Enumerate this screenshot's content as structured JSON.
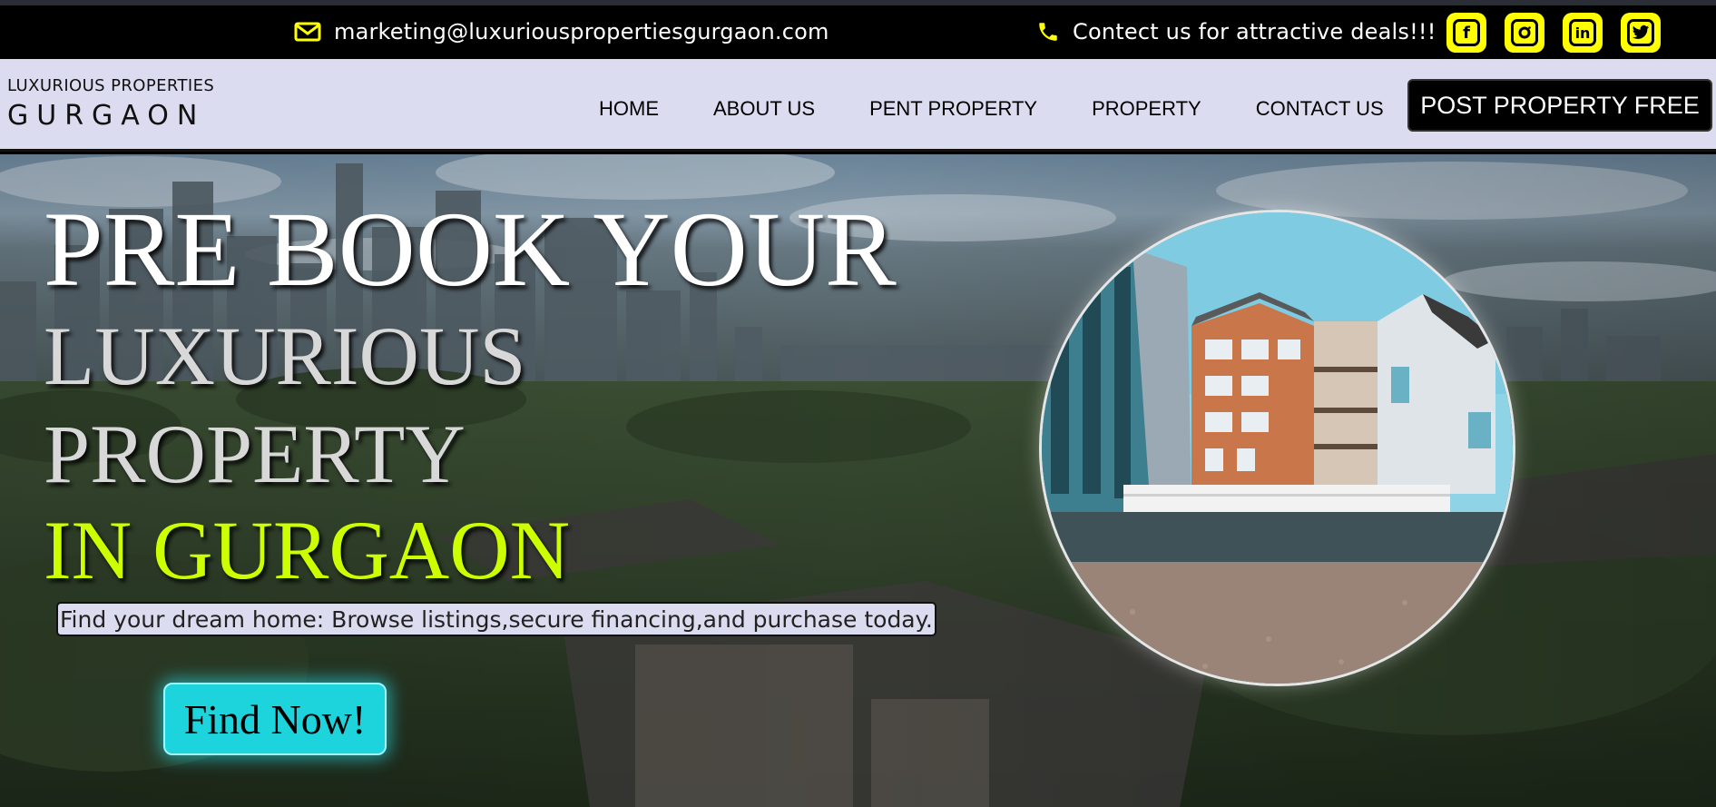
{
  "topbar": {
    "email": "marketing@luxuriouspropertiesgurgaon.com",
    "contact": "Contect us for attractive deals!!!",
    "icons": [
      "envelope-icon",
      "phone-icon"
    ],
    "socials": [
      {
        "name": "facebook-icon",
        "glyph": "f"
      },
      {
        "name": "instagram-icon",
        "glyph": "◎"
      },
      {
        "name": "linkedin-icon",
        "glyph": "in"
      },
      {
        "name": "twitter-icon",
        "glyph": "✦"
      }
    ],
    "accent_color": "#ffff00"
  },
  "brand": {
    "top": "LUXURIOUS PROPERTIES",
    "main": "GURGAON"
  },
  "nav": {
    "items": [
      "HOME",
      "ABOUT US",
      "PENT PROPERTY",
      "PROPERTY",
      "CONTACT US"
    ],
    "cta": "POST PROPERTY FREE"
  },
  "hero": {
    "line1": "PRE BOOK YOUR",
    "line2": "LUXURIOUS",
    "line3": "PROPERTY",
    "line4": "IN GURGAON",
    "tagline": "Find your dream home: Browse listings,secure financing,and purchase today.",
    "button": "Find Now!",
    "highlight_color": "#ccff00",
    "button_color": "#1dd3dc"
  }
}
